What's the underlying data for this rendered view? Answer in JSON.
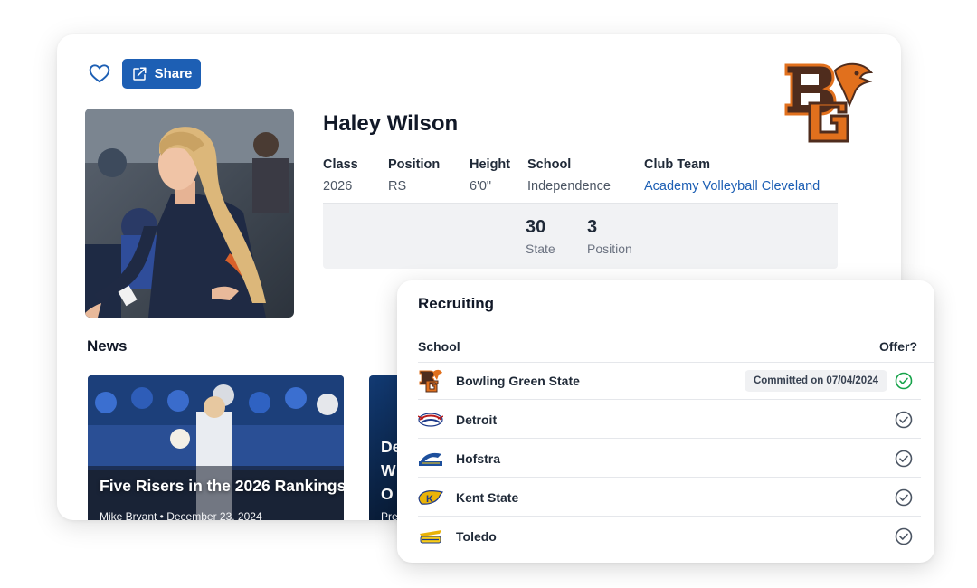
{
  "profile": {
    "name": "Haley Wilson",
    "share_label": "Share",
    "attributes": [
      {
        "label": "Class",
        "value": "2026"
      },
      {
        "label": "Position",
        "value": "RS"
      },
      {
        "label": "Height",
        "value": "6'0\""
      },
      {
        "label": "School",
        "value": "Independence"
      },
      {
        "label": "Club Team",
        "value": "Academy Volleyball Cleveland"
      }
    ],
    "rankings": [
      {
        "value": "30",
        "label": "State"
      },
      {
        "value": "3",
        "label": "Position"
      }
    ]
  },
  "news": {
    "title": "News",
    "articles": [
      {
        "headline": "Five Risers in the 2026 Rankings",
        "byline": "Mike Bryant • December 23, 2024"
      },
      {
        "headline": "De\nW\nO",
        "byline": "Pre"
      }
    ]
  },
  "recruiting": {
    "title": "Recruiting",
    "col_school": "School",
    "col_offer": "Offer?",
    "schools": [
      {
        "name": "Bowling Green State",
        "badge": "Committed on 07/04/2024",
        "logo": "bowling-green-logo",
        "status": "committed"
      },
      {
        "name": "Detroit",
        "badge": "",
        "logo": "detroit-logo",
        "status": "offer"
      },
      {
        "name": "Hofstra",
        "badge": "",
        "logo": "hofstra-logo",
        "status": "offer"
      },
      {
        "name": "Kent State",
        "badge": "",
        "logo": "kent-state-logo",
        "status": "offer"
      },
      {
        "name": "Toledo",
        "badge": "",
        "logo": "toledo-logo",
        "status": "offer"
      }
    ]
  },
  "colors": {
    "accent": "#1d5fb4",
    "bgsu_orange": "#e1701d",
    "bgsu_brown": "#4f2c1d",
    "committed_green": "#16a34a"
  }
}
